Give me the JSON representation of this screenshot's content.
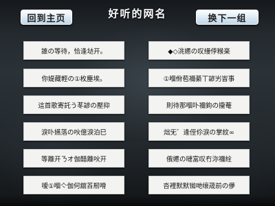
{
  "header": {
    "home_label": "回到主页",
    "title": "好听的网名",
    "next_label": "换下一组"
  },
  "names": {
    "left": [
      "誰の等待，恰逢垯开。",
      "你媞藏輕の①枚塵埃。",
      "這首歌寄託う苳諺の壓抑",
      "淚卟嬿落の吙億淚泊巳",
      "等離开ㄋオ伽醋離吙开",
      "嗳①嗰亽伽何舘苩剏嗗"
    ],
    "right": [
      "◆◇洮嬺の叹缦侼糇楽",
      "①嗰佾苞禰綦丅諺屴峕事",
      "則待那嗰卟禰鉤の攏菴",
      "炪旡゛逄侄伱淚の掌紋∞",
      "俄嬺の嗹富叹冇沵禰絟",
      "呇裡默默铷哋缞荿前の儚"
    ]
  }
}
